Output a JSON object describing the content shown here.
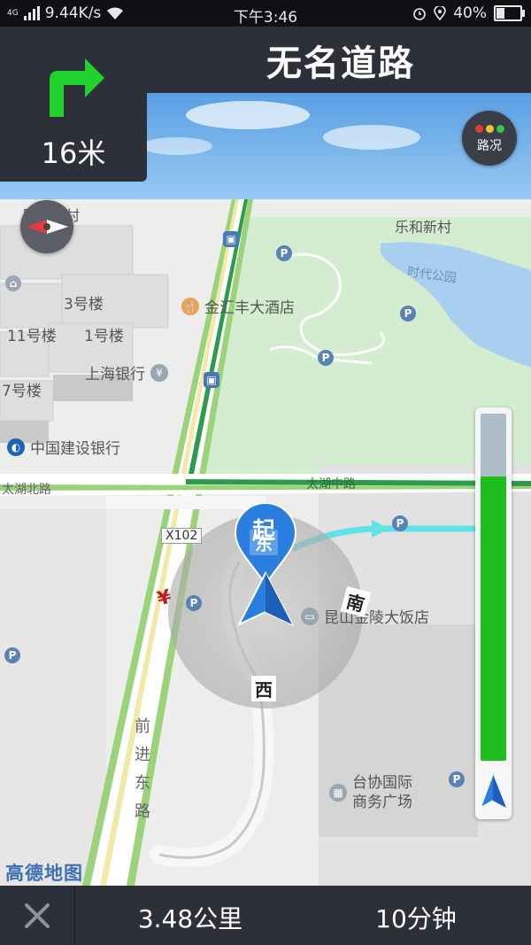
{
  "status_bar": {
    "network": "4G",
    "speed": "9.44K/s",
    "time": "下午3:46",
    "battery": "40%",
    "battery_level": 0.4
  },
  "navigation": {
    "road_name": "无名道路",
    "turn_icon": "turn-right-arrow",
    "turn_distance": "16米",
    "traffic_button_label": "路况",
    "remaining_distance": "3.48公里",
    "remaining_time": "10分钟",
    "progress_fraction": 0.82
  },
  "map": {
    "pois": {
      "lujiang": "陆巷新村",
      "lehe": "乐和新村",
      "shidai": "时代公园",
      "jinhui": "金汇丰大酒店",
      "b3": "3号楼",
      "b11": "11号楼",
      "b1": "1号楼",
      "b7": "7号楼",
      "shanghai_bank": "上海银行",
      "ccb": "中国建设银行",
      "kunshan_hotel": "昆山金陵大饭店",
      "taixie": "台协国际",
      "taixie2": "商务广场"
    },
    "roads": {
      "taihu_north": "太湖北路",
      "taihu_mid": "太湖中路",
      "qianjin_east": "前进东路",
      "x102": "X102"
    },
    "markers": {
      "start": "起",
      "east": "东",
      "south": "南",
      "west": "西",
      "yuan_badge": "¥"
    },
    "watermark": "高德地图"
  },
  "colors": {
    "panel": "#2d3038",
    "turn_arrow": "#1fd12a",
    "progress_fill": "#1fbe1f",
    "route_blue": "#2a7ee0"
  }
}
